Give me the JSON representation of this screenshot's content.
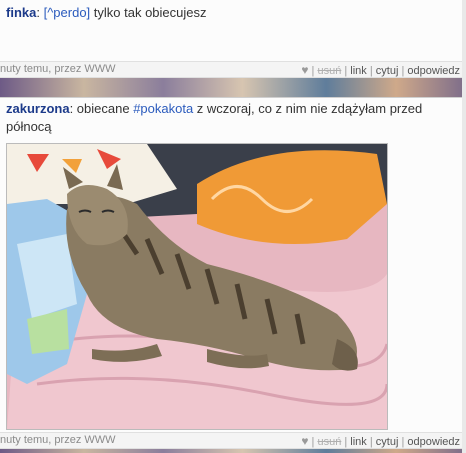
{
  "entries": [
    {
      "author": "finka",
      "tag": "[^perdo]",
      "text": " tylko tak obiecujesz",
      "meta_left": "nuty temu, przez WWW",
      "actions": {
        "heart": "♥",
        "delete": "usuń",
        "link": "link",
        "quote": "cytuj",
        "reply": "odpowiedz"
      }
    },
    {
      "author": "zakurzona",
      "text_before": ": obiecane ",
      "tag": "#pokakota",
      "text_after": " z wczoraj, co z nim nie zdążyłam przed północą",
      "meta_left": "nuty temu, przez WWW",
      "actions": {
        "heart": "♥",
        "delete": "usuń",
        "link": "link",
        "quote": "cytuj",
        "reply": "odpowiedz"
      }
    }
  ],
  "separator": "|",
  "colon": ":"
}
